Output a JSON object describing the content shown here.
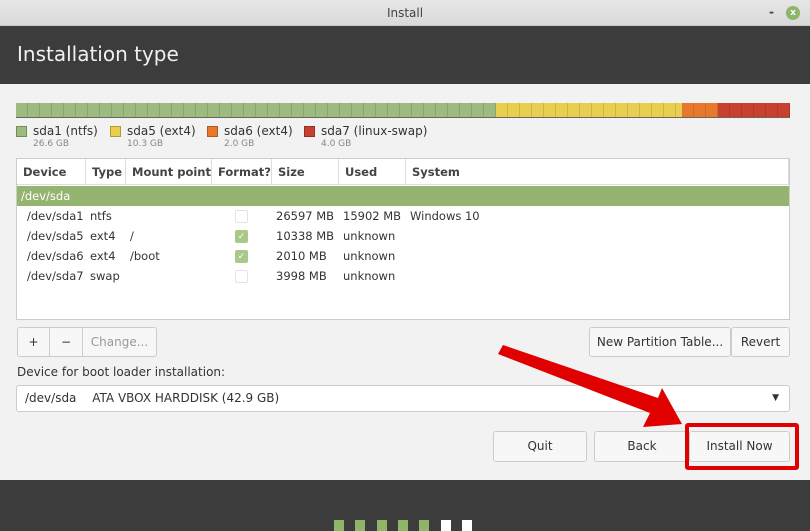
{
  "window": {
    "title": "Install",
    "minimize": "-",
    "close": "x"
  },
  "header": {
    "title": "Installation type"
  },
  "partitions_bar": [
    {
      "name": "sda1 (ntfs)",
      "size": "26.6 GB",
      "color": "#9dbb7e",
      "gb": 26.6
    },
    {
      "name": "sda5 (ext4)",
      "size": "10.3 GB",
      "color": "#e8cf4f",
      "gb": 10.3
    },
    {
      "name": "sda6 (ext4)",
      "size": "2.0 GB",
      "color": "#e8792c",
      "gb": 2.0
    },
    {
      "name": "sda7 (linux-swap)",
      "size": "4.0 GB",
      "color": "#c8402f",
      "gb": 4.0
    }
  ],
  "table": {
    "columns": [
      "Device",
      "Type",
      "Mount point",
      "Format?",
      "Size",
      "Used",
      "System"
    ],
    "disk": "/dev/sda",
    "rows": [
      {
        "device": "/dev/sda1",
        "type": "ntfs",
        "mount": "",
        "format": false,
        "size": "26597 MB",
        "used": "15902 MB",
        "system": "Windows 10"
      },
      {
        "device": "/dev/sda5",
        "type": "ext4",
        "mount": "/",
        "format": true,
        "size": "10338 MB",
        "used": "unknown",
        "system": ""
      },
      {
        "device": "/dev/sda6",
        "type": "ext4",
        "mount": "/boot",
        "format": true,
        "size": "2010 MB",
        "used": "unknown",
        "system": ""
      },
      {
        "device": "/dev/sda7",
        "type": "swap",
        "mount": "",
        "format": false,
        "size": "3998 MB",
        "used": "unknown",
        "system": ""
      }
    ]
  },
  "toolbar": {
    "add": "+",
    "remove": "−",
    "change": "Change...",
    "new_table": "New Partition Table...",
    "revert": "Revert"
  },
  "bootloader": {
    "label": "Device for boot loader installation:",
    "device": "/dev/sda",
    "description": "ATA VBOX HARDDISK (42.9 GB)"
  },
  "actions": {
    "quit": "Quit",
    "back": "Back",
    "install": "Install Now"
  },
  "progress": {
    "completed_steps": 5,
    "total_steps": 7
  },
  "colors": {
    "accent": "#8fb56a",
    "highlight": "#e00000"
  }
}
